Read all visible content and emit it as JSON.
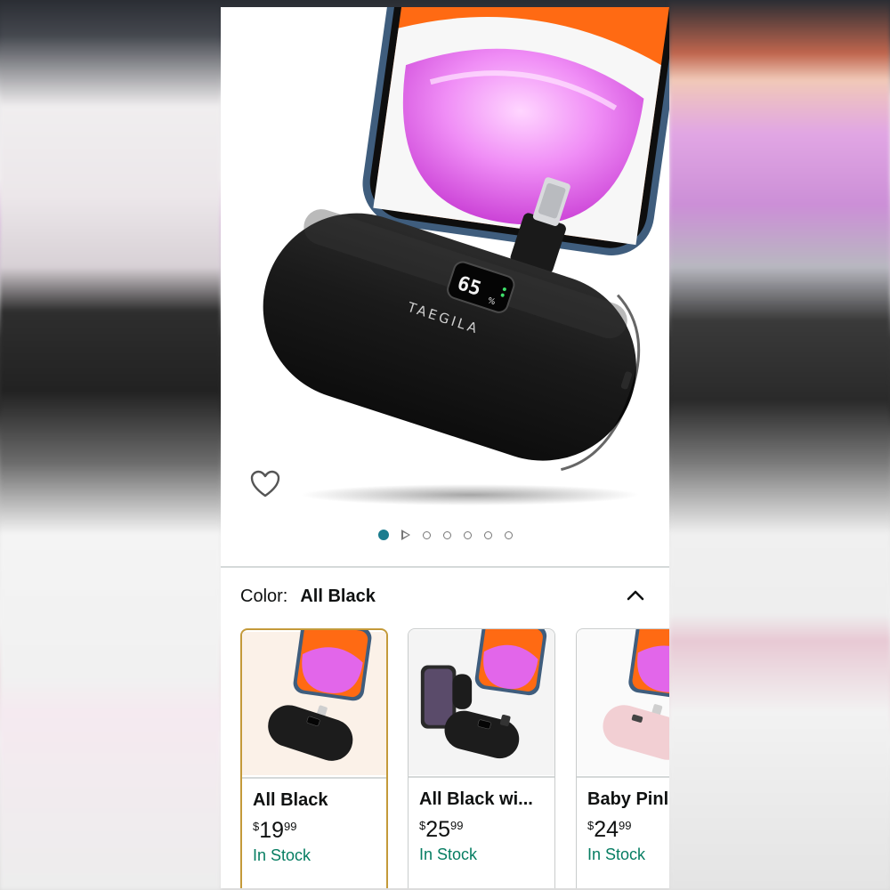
{
  "product": {
    "brand_on_device": "TAEGILA",
    "display_reading": "65"
  },
  "gallery": {
    "dot_count": 7,
    "active_index": 0,
    "video_index": 1
  },
  "color_selector": {
    "label": "Color:",
    "selected": "All Black",
    "expanded": true
  },
  "variants": [
    {
      "name": "All Black",
      "currency": "$",
      "price_whole": "19",
      "price_fraction": "99",
      "stock": "In Stock",
      "device_color": "#1c1c1c",
      "selected": true
    },
    {
      "name": "All Black wi...",
      "currency": "$",
      "price_whole": "25",
      "price_fraction": "99",
      "stock": "In Stock",
      "device_color": "#1c1c1c",
      "selected": false
    },
    {
      "name": "Baby Pinl",
      "currency": "$",
      "price_whole": "24",
      "price_fraction": "99",
      "stock": "In Stock",
      "device_color": "#f2cfd3",
      "selected": false
    }
  ],
  "colors": {
    "accent_teal": "#1b7c8e",
    "stock_green": "#067d62",
    "selected_border": "#c49a3a",
    "screen_magenta": "#e04ce6"
  }
}
